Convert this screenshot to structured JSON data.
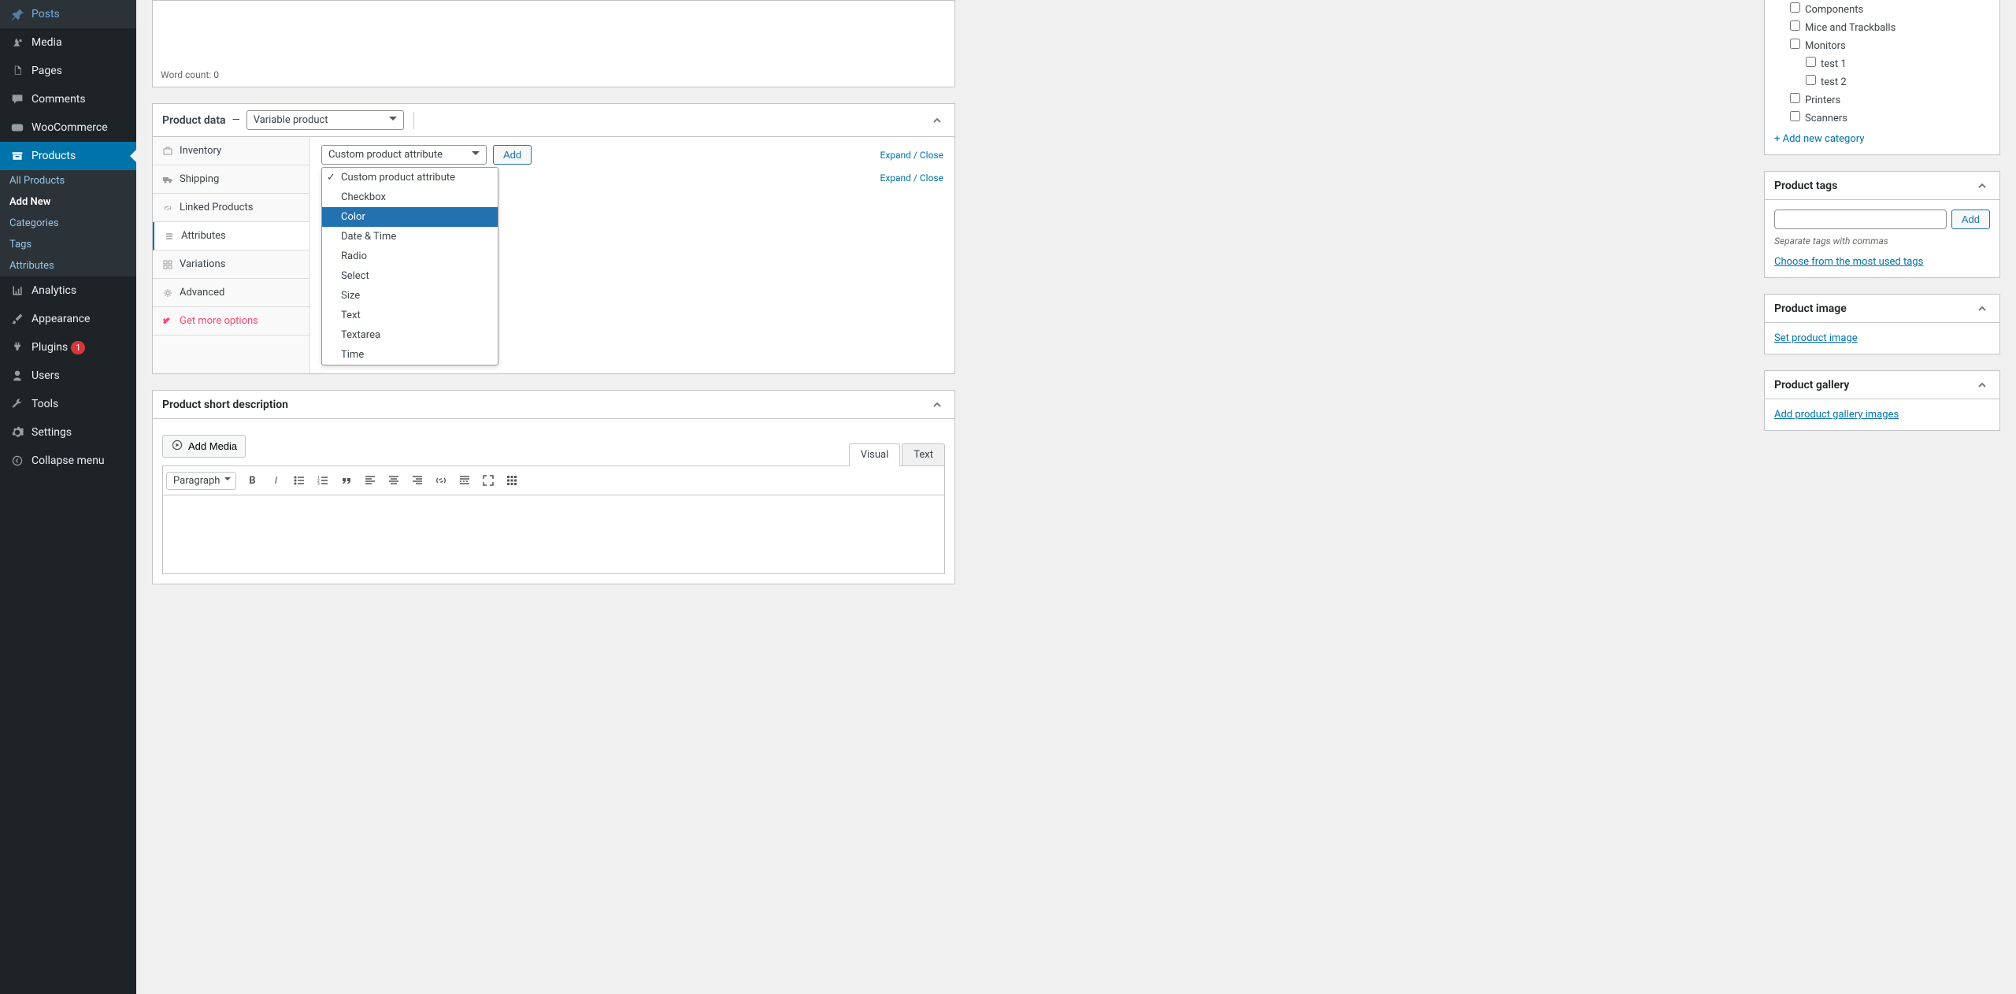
{
  "sidebar": {
    "items": [
      {
        "label": "Posts",
        "icon": "pin"
      },
      {
        "label": "Media",
        "icon": "media"
      },
      {
        "label": "Pages",
        "icon": "pages"
      },
      {
        "label": "Comments",
        "icon": "comment"
      },
      {
        "label": "WooCommerce",
        "icon": "woo"
      },
      {
        "label": "Products",
        "icon": "archive"
      }
    ],
    "submenu": [
      {
        "label": "All Products"
      },
      {
        "label": "Add New"
      },
      {
        "label": "Categories"
      },
      {
        "label": "Tags"
      },
      {
        "label": "Attributes"
      }
    ],
    "items2": [
      {
        "label": "Analytics",
        "icon": "chart"
      },
      {
        "label": "Appearance",
        "icon": "brush"
      },
      {
        "label": "Plugins",
        "icon": "plug",
        "badge": "1"
      },
      {
        "label": "Users",
        "icon": "user"
      },
      {
        "label": "Tools",
        "icon": "wrench"
      },
      {
        "label": "Settings",
        "icon": "gear"
      },
      {
        "label": "Collapse menu",
        "icon": "collapse"
      }
    ]
  },
  "editor": {
    "word_count_label": "Word count:",
    "word_count_value": "0"
  },
  "product_data": {
    "title": "Product data",
    "dash": "—",
    "type_select": "Variable product",
    "tabs": [
      {
        "label": "Inventory",
        "icon": "inventory"
      },
      {
        "label": "Shipping",
        "icon": "truck"
      },
      {
        "label": "Linked Products",
        "icon": "link"
      },
      {
        "label": "Attributes",
        "icon": "list"
      },
      {
        "label": "Variations",
        "icon": "grid"
      },
      {
        "label": "Advanced",
        "icon": "gear"
      },
      {
        "label": "Get more options",
        "icon": "wand"
      }
    ],
    "attr_select_label": "Custom product attribute",
    "add_btn": "Add",
    "expand_label": "Expand",
    "close_label": "Close",
    "slash": " / ",
    "dropdown": [
      {
        "label": "Custom product attribute",
        "selected": true
      },
      {
        "label": "Checkbox"
      },
      {
        "label": "Color",
        "highlighted": true
      },
      {
        "label": "Date & Time"
      },
      {
        "label": "Radio"
      },
      {
        "label": "Select"
      },
      {
        "label": "Size"
      },
      {
        "label": "Text"
      },
      {
        "label": "Textarea"
      },
      {
        "label": "Time"
      }
    ]
  },
  "short_desc": {
    "title": "Product short description",
    "add_media": "Add Media",
    "visual_tab": "Visual",
    "text_tab": "Text",
    "paragraph_label": "Paragraph"
  },
  "categories": {
    "items": [
      {
        "label": "Components",
        "indent": 1
      },
      {
        "label": "Mice and Trackballs",
        "indent": 1
      },
      {
        "label": "Monitors",
        "indent": 1
      },
      {
        "label": "test 1",
        "indent": 2
      },
      {
        "label": "test 2",
        "indent": 2
      },
      {
        "label": "Printers",
        "indent": 1
      },
      {
        "label": "Scanners",
        "indent": 1
      }
    ],
    "add_new": "+ Add new category"
  },
  "tags_box": {
    "title": "Product tags",
    "add_btn": "Add",
    "hint": "Separate tags with commas",
    "choose_link": "Choose from the most used tags"
  },
  "image_box": {
    "title": "Product image",
    "set_link": "Set product image"
  },
  "gallery_box": {
    "title": "Product gallery",
    "add_link": "Add product gallery images"
  }
}
